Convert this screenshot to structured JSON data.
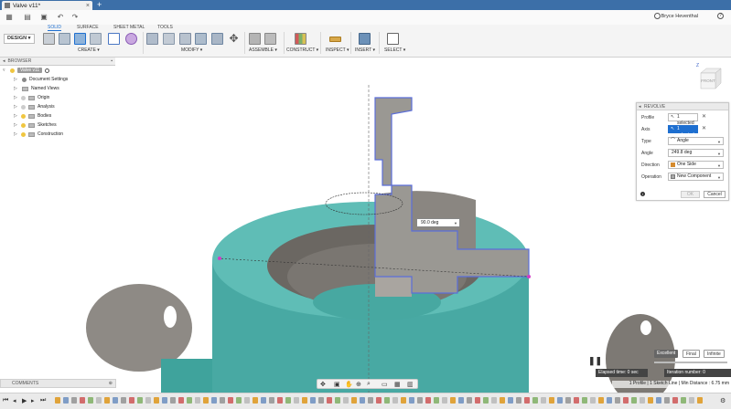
{
  "window": {
    "tab_title": "Valve v11*",
    "user": "Bryce Heventhal"
  },
  "workspace": {
    "mode": "DESIGN",
    "tabs": [
      {
        "label": "SOLID",
        "active": true
      },
      {
        "label": "SURFACE"
      },
      {
        "label": "SHEET METAL"
      },
      {
        "label": "TOOLS"
      }
    ],
    "groups": [
      {
        "label": "CREATE"
      },
      {
        "label": "MODIFY"
      },
      {
        "label": "ASSEMBLE"
      },
      {
        "label": "CONSTRUCT"
      },
      {
        "label": "INSPECT"
      },
      {
        "label": "INSERT"
      },
      {
        "label": "SELECT"
      }
    ]
  },
  "browser": {
    "header": "BROWSER",
    "root": "Valve v11",
    "items": [
      {
        "label": "Document Settings",
        "icon": "gear-icon"
      },
      {
        "label": "Named Views",
        "icon": "folder-icon"
      },
      {
        "label": "Origin",
        "icon": "folder-icon"
      },
      {
        "label": "Analysis",
        "icon": "folder-icon"
      },
      {
        "label": "Bodies",
        "icon": "folder-icon"
      },
      {
        "label": "Sketches",
        "icon": "folder-icon"
      },
      {
        "label": "Construction",
        "icon": "folder-icon"
      }
    ]
  },
  "viewcube": {
    "face": "FRONT",
    "axis": "Z"
  },
  "revolve": {
    "title": "REVOLVE",
    "profile_label": "Profile",
    "profile_value": "1 selected",
    "axis_label": "Axis",
    "axis_value": "1 selected",
    "type_label": "Type",
    "type_value": "Angle",
    "angle_label": "Angle",
    "angle_value": "249.8 deg",
    "direction_label": "Direction",
    "direction_value": "One Side",
    "operation_label": "Operation",
    "operation_value": "New Component",
    "ok_label": "OK",
    "cancel_label": "Cancel"
  },
  "canvas": {
    "angle_input": "90.0 deg"
  },
  "comments": {
    "label": "COMMENTS"
  },
  "progress": {
    "quality": [
      {
        "label": "Excellent"
      },
      {
        "label": "Final"
      },
      {
        "label": "Infinite"
      }
    ],
    "elapsed": "Elapsed time: 0 sec",
    "iteration": "Iteration number: 0"
  },
  "status": "1 Profile | 1 Sketch Line | Min Distance : 6.75 mm",
  "colors": {
    "titlebar": "#3c6fa8",
    "accent": "#1e6fd0",
    "teal": "#48a9a3",
    "gray_body": "#8e8a85",
    "sketch": "#5b6ed9"
  }
}
